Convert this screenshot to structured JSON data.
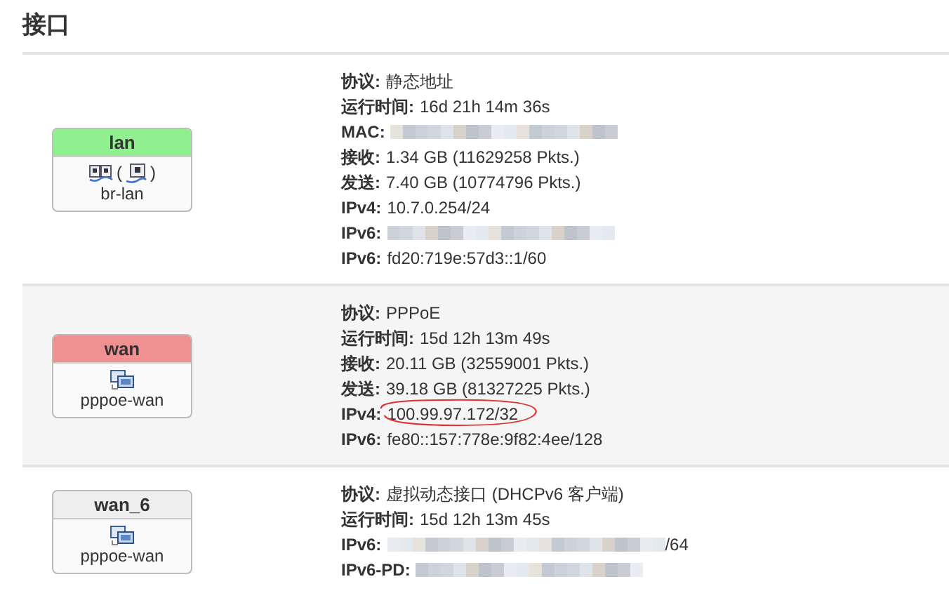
{
  "title": "接口",
  "interfaces": [
    {
      "name": "lan",
      "color": "#90f090",
      "icon_row": [
        {
          "kind": "switch"
        },
        {
          "kind": "text",
          "text": "("
        },
        {
          "kind": "port"
        },
        {
          "kind": "text",
          "text": ")"
        }
      ],
      "device": "br-lan",
      "fields": [
        {
          "label": "协议:",
          "value": "静态地址"
        },
        {
          "label": "运行时间:",
          "value": "16d 21h 14m 36s"
        },
        {
          "label": "MAC:",
          "kind": "redacted"
        },
        {
          "label": "接收:",
          "value": "1.34 GB (11629258 Pkts.)"
        },
        {
          "label": "发送:",
          "value": "7.40 GB (10774796 Pkts.)"
        },
        {
          "label": "IPv4:",
          "value": "10.7.0.254/24"
        },
        {
          "label": "IPv6:",
          "kind": "redacted"
        },
        {
          "label": "IPv6:",
          "value": "fd20:719e:57d3::1/60"
        }
      ]
    },
    {
      "name": "wan",
      "color": "#f09090",
      "icon_row": [
        {
          "kind": "network"
        }
      ],
      "device": "pppoe-wan",
      "fields": [
        {
          "label": "协议:",
          "value": "PPPoE"
        },
        {
          "label": "运行时间:",
          "value": "15d 12h 13m 49s"
        },
        {
          "label": "接收:",
          "value": "20.11 GB (32559001 Pkts.)"
        },
        {
          "label": "发送:",
          "value": "39.18 GB (81327225 Pkts.)"
        },
        {
          "label": "IPv4:",
          "value": "100.99.97.172/32",
          "circled": true
        },
        {
          "label": "IPv6:",
          "value": "fe80::157:778e:9f82:4ee/128"
        }
      ]
    },
    {
      "name": "wan_6",
      "color": "#eeeeee",
      "icon_row": [
        {
          "kind": "network"
        }
      ],
      "device": "pppoe-wan",
      "fields": [
        {
          "label": "协议:",
          "value": "虚拟动态接口 (DHCPv6 客户端)"
        },
        {
          "label": "运行时间:",
          "value": "15d 12h 13m 45s"
        },
        {
          "label": "IPv6:",
          "kind": "redacted",
          "value": "/64"
        },
        {
          "label": "IPv6-PD:",
          "kind": "redacted"
        }
      ]
    }
  ]
}
